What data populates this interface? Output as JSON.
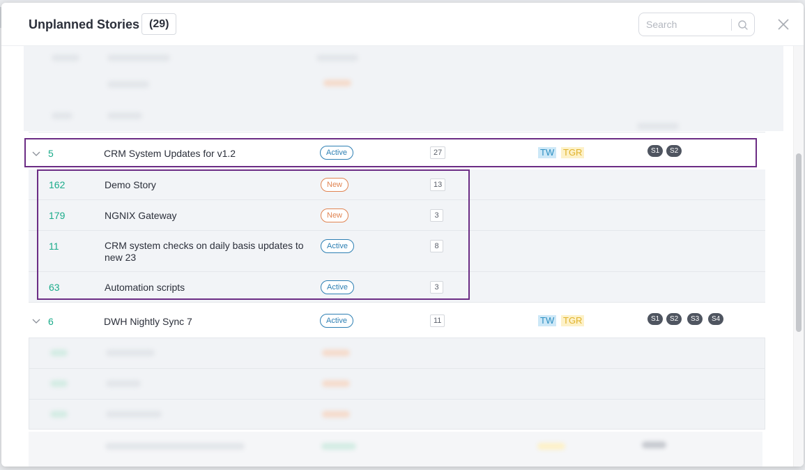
{
  "header": {
    "title": "Unplanned Stories",
    "count": "(29)",
    "search_placeholder": "Search"
  },
  "epics": [
    {
      "id": "5",
      "name": "CRM System Updates for v1.2",
      "status": "Active",
      "points": "27",
      "teams": [
        "TW",
        "TGR"
      ],
      "sprints": [
        "S1",
        "S2"
      ],
      "stories": [
        {
          "id": "162",
          "name": "Demo Story",
          "status": "New",
          "points": "13"
        },
        {
          "id": "179",
          "name": "NGNIX Gateway",
          "status": "New",
          "points": "3"
        },
        {
          "id": "11",
          "name": "CRM system checks on daily basis updates to new 23",
          "status": "Active",
          "points": "8"
        },
        {
          "id": "63",
          "name": "Automation scripts",
          "status": "Active",
          "points": "3"
        }
      ]
    },
    {
      "id": "6",
      "name": "DWH Nightly Sync 7",
      "status": "Active",
      "points": "11",
      "teams": [
        "TW",
        "TGR"
      ],
      "sprints": [
        "S1",
        "S2",
        "S3",
        "S4"
      ]
    }
  ],
  "colors": {
    "accent_id": "#1aab8a",
    "active": "#2d7fb3",
    "new": "#e08452",
    "highlight": "#6b2c84"
  }
}
